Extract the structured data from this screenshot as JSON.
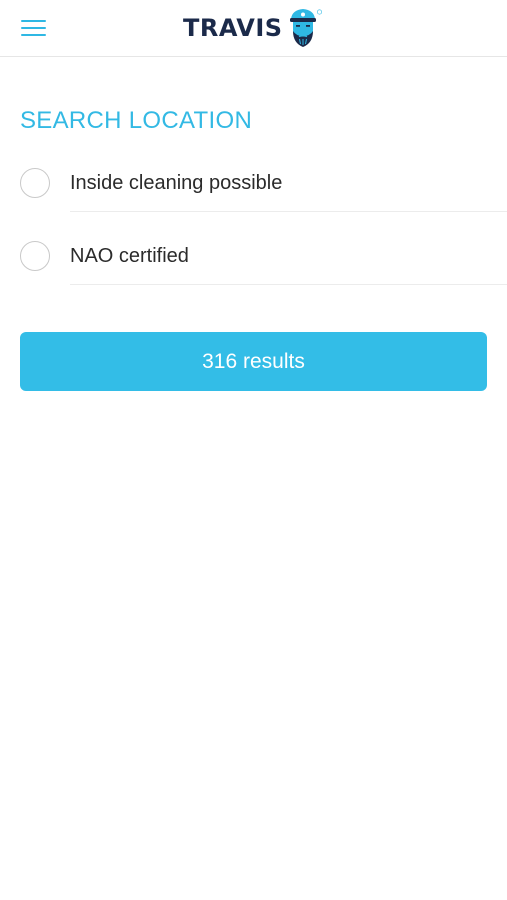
{
  "header": {
    "menu_icon": "hamburger-menu-icon",
    "logo_text": "TRAVIS",
    "logo_icon": "captain-face-icon",
    "accent_color": "#2fb8e4",
    "brand_color": "#1b2a4a"
  },
  "filters": {
    "title": "SEARCH LOCATION",
    "options": [
      {
        "label": "Inside cleaning possible",
        "checked": false
      },
      {
        "label": "NAO certified",
        "checked": false
      }
    ]
  },
  "results_button": {
    "label": "316 results",
    "color": "#33bde7"
  }
}
